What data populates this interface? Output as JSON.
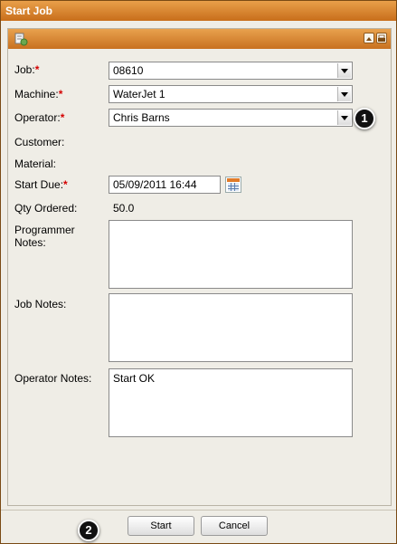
{
  "window": {
    "title": "Start Job"
  },
  "panel": {
    "header_icon": "form-icon",
    "header_buttons": [
      "collapse-icon",
      "print-icon"
    ]
  },
  "form": {
    "job": {
      "label": "Job:",
      "required": "*",
      "value": "08610"
    },
    "machine": {
      "label": "Machine:",
      "required": "*",
      "value": "WaterJet 1"
    },
    "operator": {
      "label": "Operator:",
      "required": "*",
      "value": "Chris Barns"
    },
    "customer": {
      "label": "Customer:",
      "value": ""
    },
    "material": {
      "label": "Material:",
      "value": ""
    },
    "start_due": {
      "label": "Start Due:",
      "required": "*",
      "value": "05/09/2011 16:44"
    },
    "qty_ordered": {
      "label": "Qty Ordered:",
      "value": "50.0"
    },
    "programmer_notes": {
      "label_line1": "Programmer",
      "label_line2": "Notes:",
      "value": ""
    },
    "job_notes": {
      "label": "Job Notes:",
      "value": ""
    },
    "operator_notes": {
      "label": "Operator Notes:",
      "value": "Start OK"
    }
  },
  "callouts": {
    "one": "1",
    "two": "2"
  },
  "footer": {
    "start_label": "Start",
    "cancel_label": "Cancel"
  }
}
